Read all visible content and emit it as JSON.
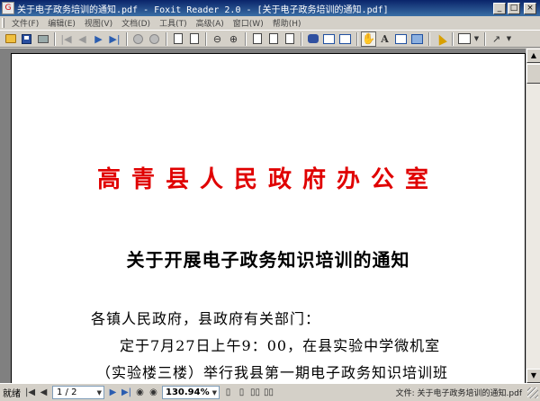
{
  "window": {
    "title": "关于电子政务培训的通知.pdf - Foxit Reader 2.0 - [关于电子政务培训的通知.pdf]",
    "app_icon": "G",
    "buttons": [
      "_",
      "□",
      "×"
    ]
  },
  "menu": {
    "items": [
      "文件(F)",
      "编辑(E)",
      "视图(V)",
      "文档(D)",
      "工具(T)",
      "高级(A)",
      "窗口(W)",
      "帮助(H)"
    ]
  },
  "toolbar": {
    "icons": [
      "open-folder-icon",
      "save-icon",
      "print-icon",
      "first-page-icon",
      "prev-page-icon",
      "next-page-icon",
      "last-page-icon",
      "go-back-icon",
      "go-forward-icon",
      "rotate-icon",
      "zoom-out-icon",
      "zoom-in-icon",
      "actual-size-icon",
      "fit-page-icon",
      "fit-width-icon",
      "find-icon",
      "bookmarks-icon",
      "thumbnails-icon",
      "hand-tool-icon",
      "text-select-icon",
      "snapshot-icon",
      "image-tool-icon",
      "select-cursor-icon",
      "annotate-icon",
      "arrow-tool-icon"
    ]
  },
  "document": {
    "office_name": "高青县人民政府办公室",
    "notice_title": "关于开展电子政务知识培训的通知",
    "lines": [
      "各镇人民政府，县政府有关部门：",
      "定于7月27日上午9：00，在县实验中学微机室",
      "（实验楼三楼）举行我县第一期电子政务知识培训班"
    ],
    "office_color": "#e00000"
  },
  "status": {
    "state": "就绪",
    "page_value": "1 / 2",
    "zoom_value": "130.94%",
    "file_label": "文件: 关于电子政务培训的通知.pdf"
  }
}
